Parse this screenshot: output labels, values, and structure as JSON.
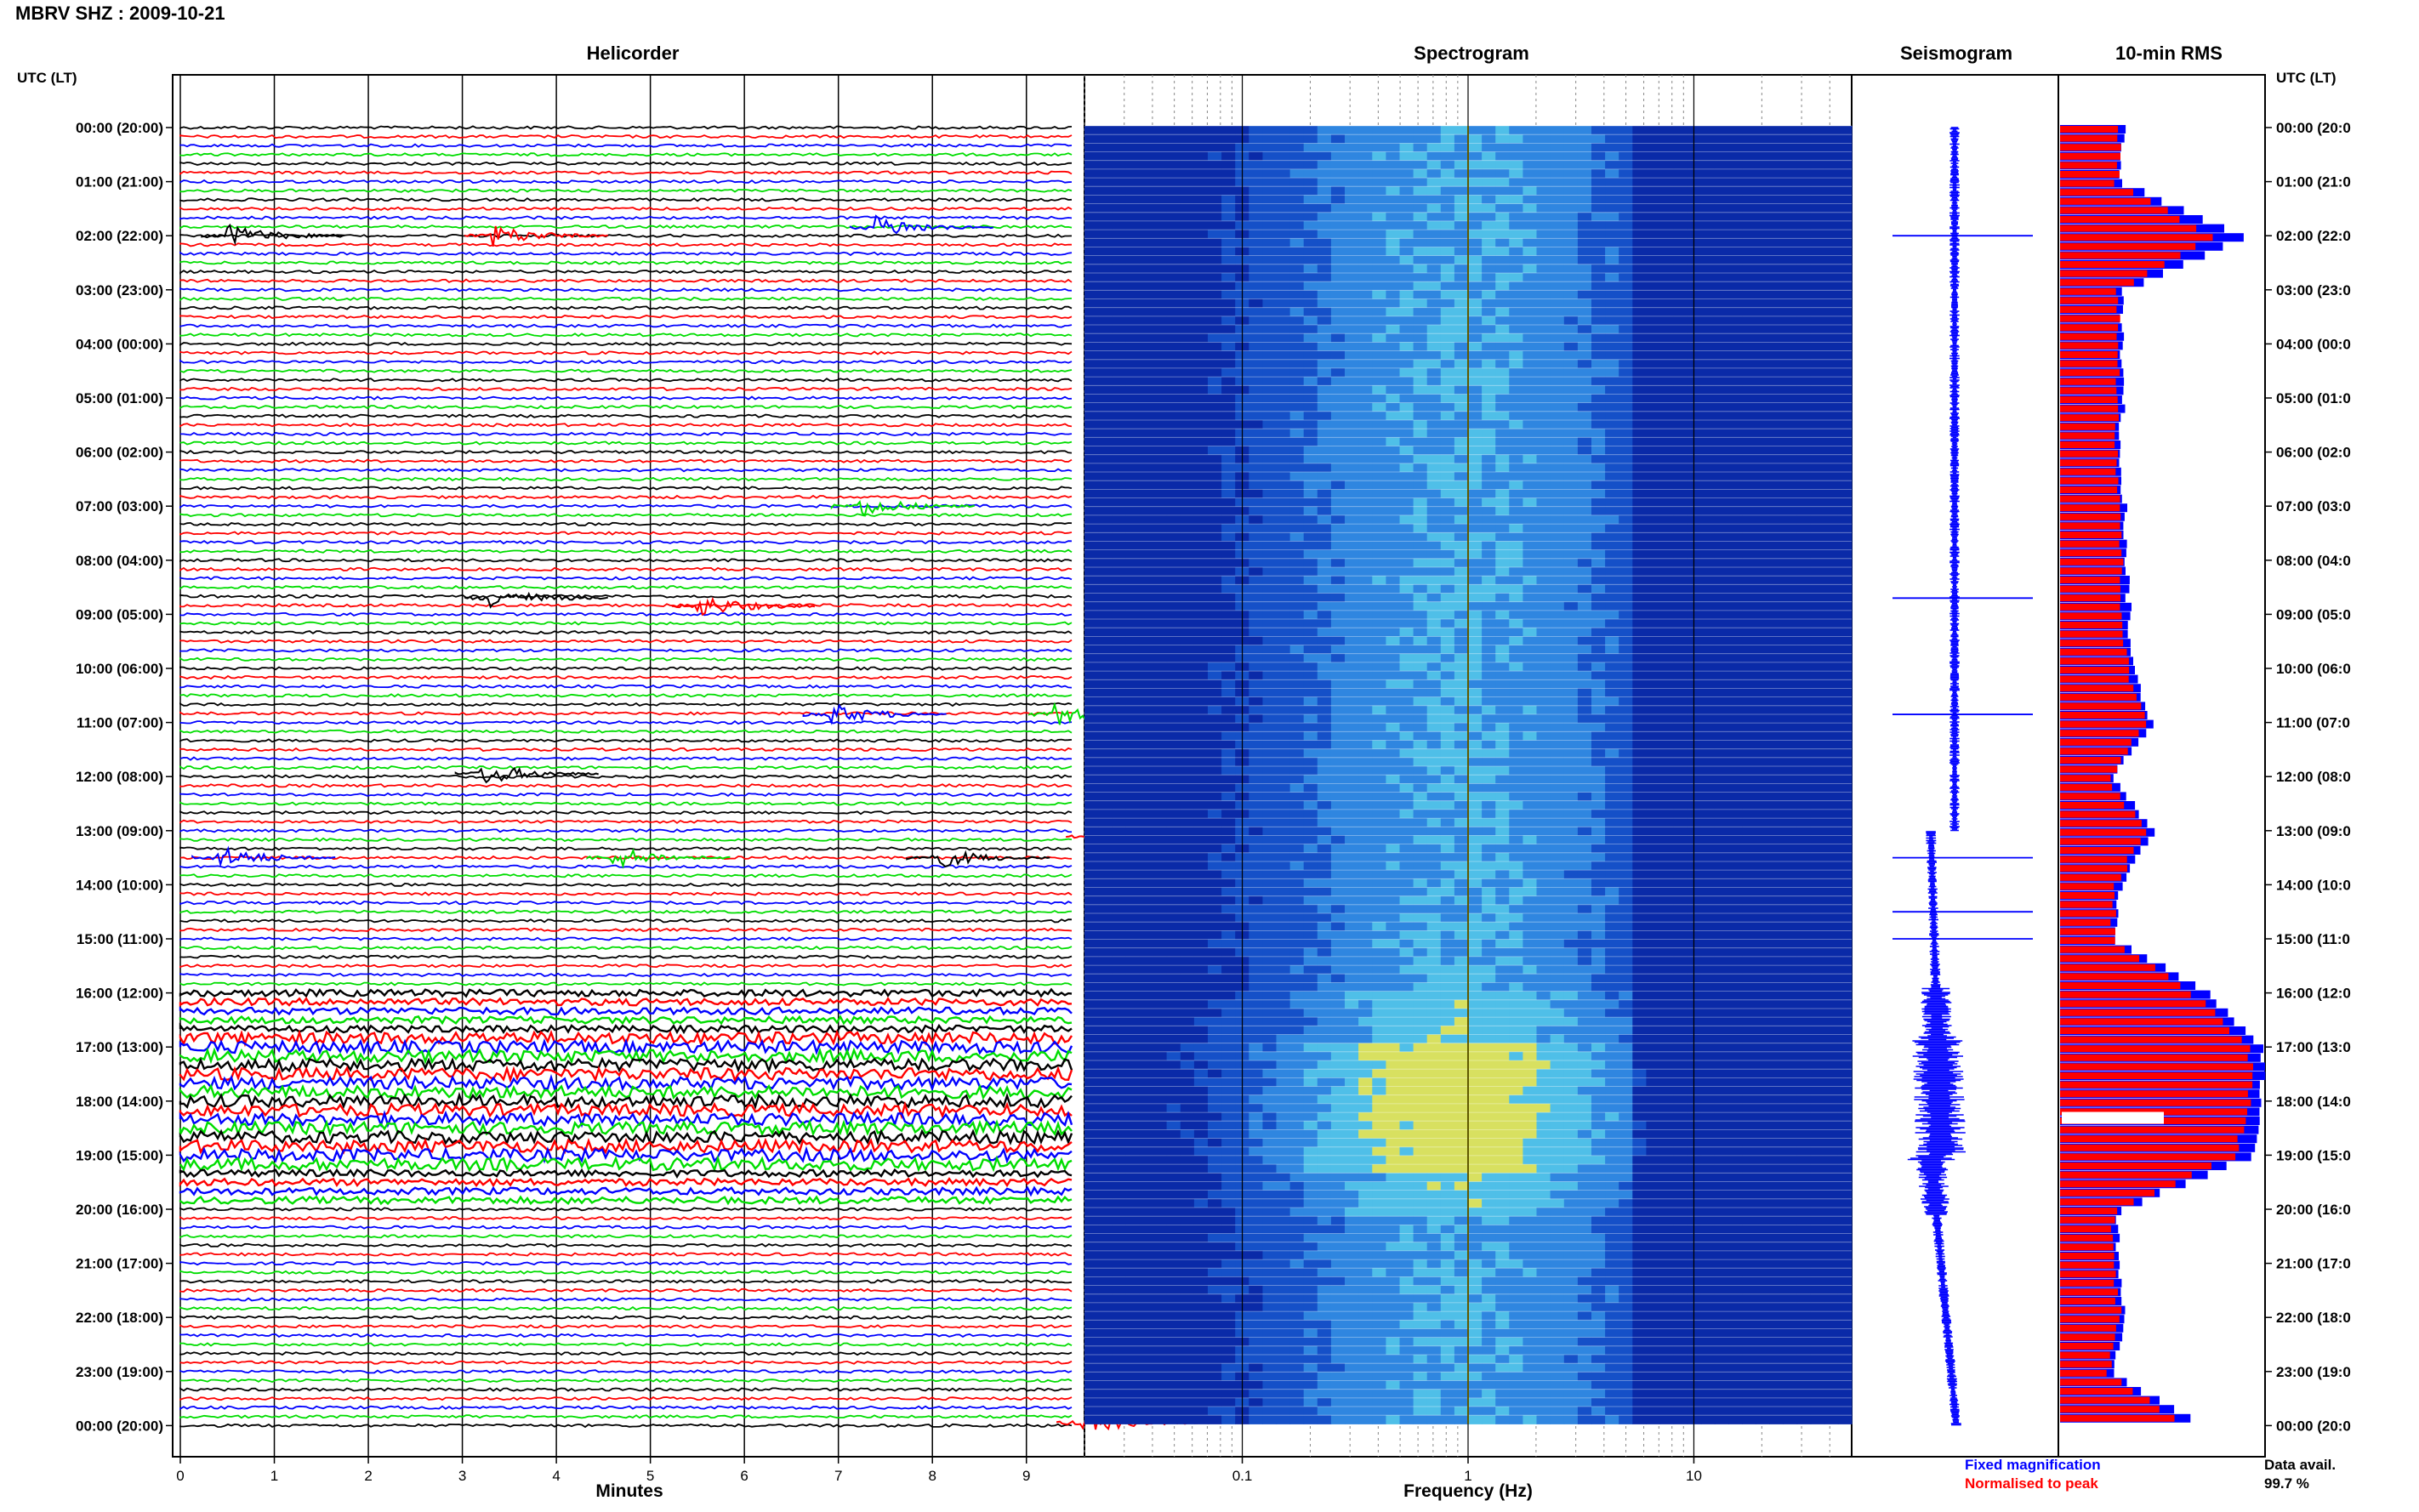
{
  "header": {
    "station_title": "MBRV SHZ : 2009-10-21",
    "utc_lt_label_left": "UTC (LT)",
    "utc_lt_label_right": "UTC (LT)"
  },
  "panels": {
    "helicorder": "Helicorder",
    "spectrogram": "Spectrogram",
    "seismogram": "Seismogram",
    "rms": "10-min RMS"
  },
  "legend": {
    "fixed": "Fixed magnification",
    "normalised": "Normalised to peak",
    "fixed_color": "#0000ff",
    "normalised_color": "#ff0000"
  },
  "data_availability": {
    "label": "Data avail.",
    "value": "99.7 %"
  },
  "colors": {
    "trace_cycle": [
      "#000000",
      "#ff0000",
      "#0000ff",
      "#00dd00"
    ],
    "spectrogram_dark": "#001c9e",
    "spectrogram_mid": "#2f86e0",
    "spectrogram_hot": "#f0e000"
  },
  "chart_data": [
    {
      "type": "line",
      "name": "helicorder",
      "title": "Helicorder",
      "xlabel": "Minutes",
      "xlim": [
        0,
        10
      ],
      "x_ticks": [
        "0",
        "1",
        "2",
        "3",
        "4",
        "5",
        "6",
        "7",
        "8",
        "9"
      ],
      "y_tick_labels": [
        "00:00 (20:00)",
        "01:00 (21:00)",
        "02:00 (22:00)",
        "03:00 (23:00)",
        "04:00 (00:00)",
        "05:00 (01:00)",
        "06:00 (02:00)",
        "07:00 (03:00)",
        "08:00 (04:00)",
        "09:00 (05:00)",
        "10:00 (06:00)",
        "11:00 (07:00)",
        "12:00 (08:00)",
        "13:00 (09:00)",
        "14:00 (10:00)",
        "15:00 (11:00)",
        "16:00 (12:00)",
        "17:00 (13:00)",
        "18:00 (14:00)",
        "19:00 (15:00)",
        "20:00 (16:00)",
        "21:00 (17:00)",
        "22:00 (18:00)",
        "23:00 (19:00)",
        "00:00 (20:00)"
      ],
      "y_tick_labels_right": [
        "00:00 (20:0",
        "01:00 (21:0",
        "02:00 (22:0",
        "03:00 (23:0",
        "04:00 (00:0",
        "05:00 (01:0",
        "06:00 (02:0",
        "07:00 (03:0",
        "08:00 (04:0",
        "09:00 (05:0",
        "10:00 (06:0",
        "11:00 (07:0",
        "12:00 (08:0",
        "13:00 (09:0",
        "14:00 (10:0",
        "15:00 (11:0",
        "16:00 (12:0",
        "17:00 (13:0",
        "18:00 (14:0",
        "19:00 (15:0",
        "20:00 (16:0",
        "21:00 (17:0",
        "22:00 (18:0",
        "23:00 (19:0",
        "00:00 (20:0"
      ],
      "traces_per_hour": 6,
      "high_activity_hours": [
        16,
        17,
        18,
        19
      ],
      "events": [
        {
          "hour": 2.0,
          "minute": 0.5
        },
        {
          "hour": 2.0,
          "minute": 3.3
        },
        {
          "hour": 1.85,
          "minute": 7.4
        },
        {
          "hour": 7.0,
          "minute": 7.2
        },
        {
          "hour": 8.7,
          "minute": 3.3
        },
        {
          "hour": 8.85,
          "minute": 5.5
        },
        {
          "hour": 10.85,
          "minute": 6.9
        },
        {
          "hour": 10.85,
          "minute": 9.3
        },
        {
          "hour": 11.95,
          "minute": 3.2
        },
        {
          "hour": 13.1,
          "minute": 9.7
        },
        {
          "hour": 13.5,
          "minute": 0.4
        },
        {
          "hour": 13.5,
          "minute": 4.6
        },
        {
          "hour": 13.5,
          "minute": 8.0
        },
        {
          "hour": 23.95,
          "minute": 9.6
        }
      ]
    },
    {
      "type": "heatmap",
      "name": "spectrogram",
      "title": "Spectrogram",
      "xlabel": "Frequency (Hz)",
      "x_scale": "log",
      "xlim": [
        0.02,
        50
      ],
      "x_tick_labels": [
        "0.1",
        "1",
        "10"
      ],
      "x_tick_values": [
        0.1,
        1,
        10
      ],
      "peak_frequency_hz": 1
    },
    {
      "type": "line",
      "name": "seismogram",
      "title": "Seismogram"
    },
    {
      "type": "bar",
      "name": "rms",
      "title": "10-min RMS",
      "series_fixed_magnification_hourly": [
        3.2,
        3.0,
        9.2,
        3.0,
        3.1,
        3.1,
        3.0,
        3.2,
        3.3,
        3.4,
        3.6,
        4.6,
        2.6,
        4.6,
        3.0,
        2.8,
        7.4,
        10.0,
        10.0,
        9.4,
        2.9,
        2.8,
        3.3,
        2.6,
        7.2
      ],
      "series_normalised_hourly": [
        3.0,
        2.8,
        7.6,
        2.8,
        2.9,
        2.9,
        2.8,
        3.0,
        3.0,
        3.1,
        3.3,
        4.3,
        2.4,
        4.2,
        2.7,
        2.6,
        6.6,
        9.4,
        9.4,
        8.6,
        2.7,
        2.6,
        3.0,
        2.4,
        6.2
      ]
    }
  ]
}
